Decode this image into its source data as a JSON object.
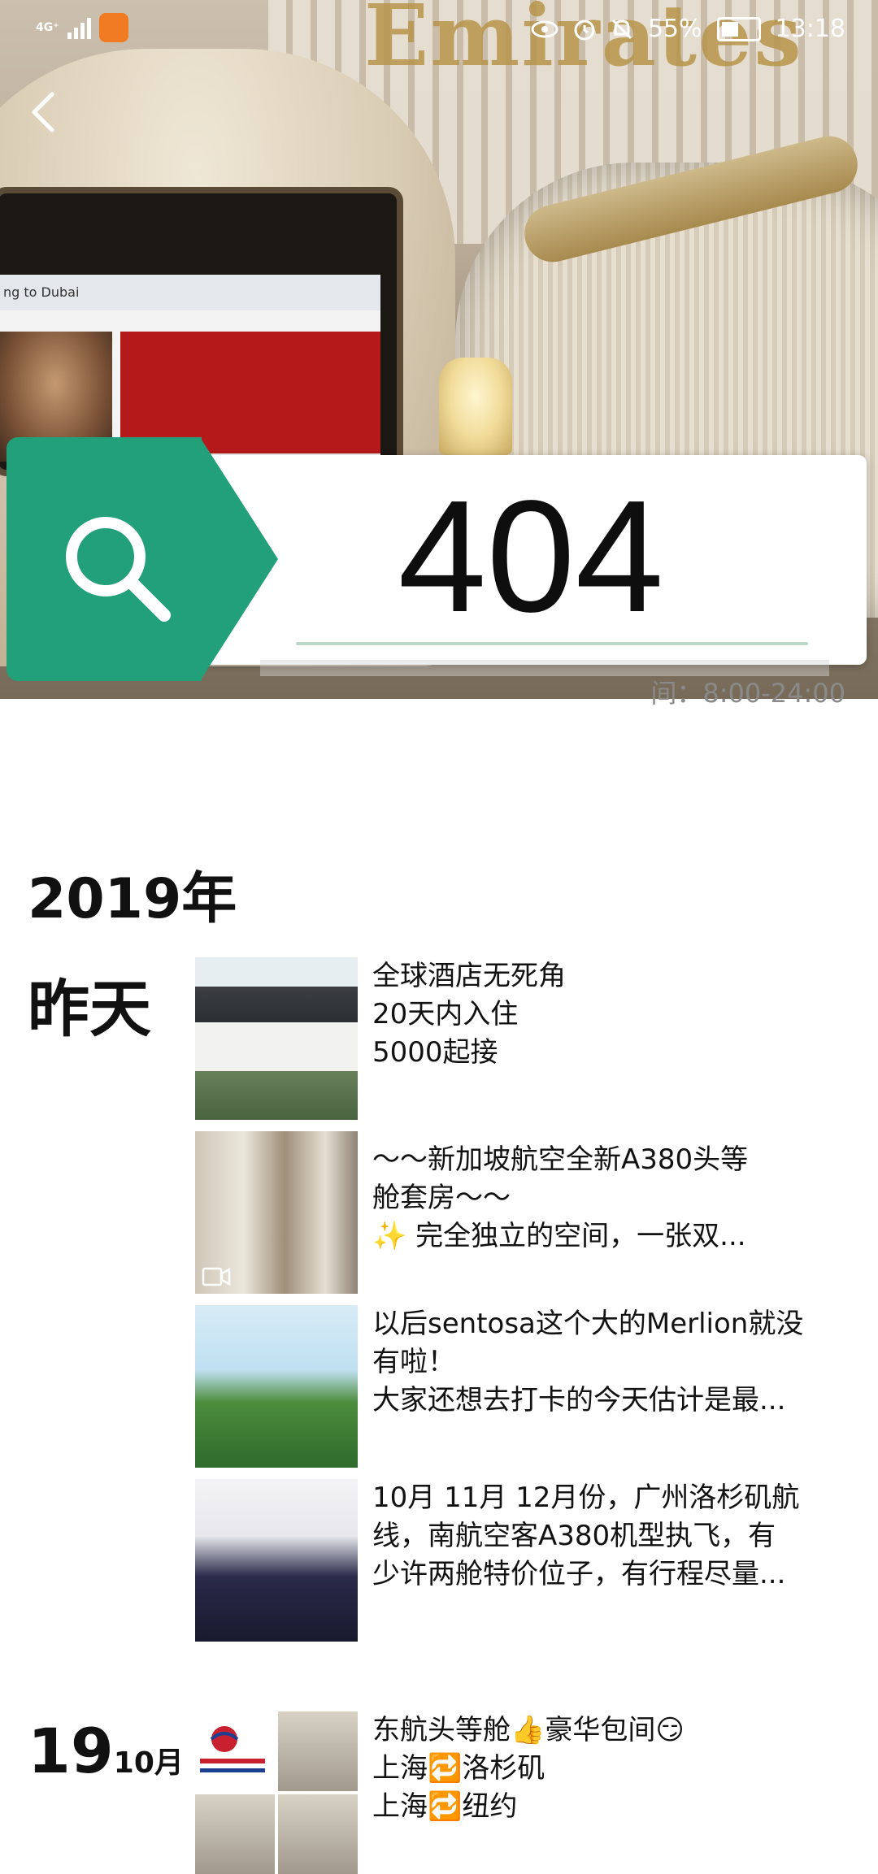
{
  "status_bar": {
    "network": "4G⁺",
    "battery": "55%",
    "time": "13:18"
  },
  "cover": {
    "brand_text": "Emirates",
    "screen_text": "ng to Dubai"
  },
  "error": {
    "code": "404"
  },
  "service": {
    "hours": "间：8:00-24:00"
  },
  "timeline": {
    "year": "2019年",
    "groups": [
      {
        "label": "昨天",
        "posts": [
          {
            "lines": [
              "全球酒店无死角",
              "20天内入住",
              "5000起接"
            ]
          },
          {
            "lines": [
              "～～新加坡航空全新A380头等",
              "舱套房～～",
              "✨ 完全独立的空间，一张双..."
            ]
          },
          {
            "lines": [
              "以后sentosa这个大的Merlion就没",
              "有啦！",
              "大家还想去打卡的今天估计是最..."
            ]
          },
          {
            "lines": [
              "10月 11月  12月份，广州洛杉矶航",
              "线，南航空客A380机型执飞，有",
              "少许两舱特价位子，有行程尽量..."
            ]
          }
        ]
      },
      {
        "label_day": "19",
        "label_month": "10月",
        "posts": [
          {
            "lines": [
              "东航头等舱👍豪华包间😏",
              "上海🔁洛杉矶",
              "上海🔁纽约"
            ]
          }
        ]
      }
    ]
  }
}
